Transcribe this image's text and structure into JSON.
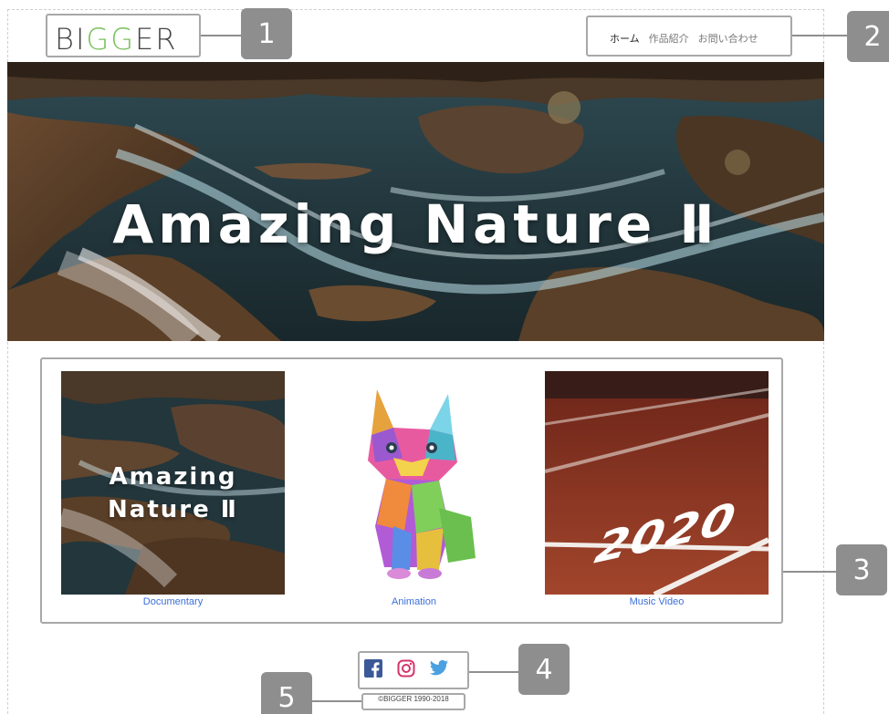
{
  "brand": {
    "logo_prefix": "BI",
    "logo_highlight": "GG",
    "logo_suffix": "ER"
  },
  "nav": {
    "items": [
      {
        "label": "ホーム"
      },
      {
        "label": "作品紹介"
      },
      {
        "label": "お問い合わせ"
      }
    ]
  },
  "hero": {
    "title": "Amazing Nature Ⅱ"
  },
  "works": {
    "items": [
      {
        "caption": "Documentary",
        "thumb_title": "Amazing\nNature Ⅱ"
      },
      {
        "caption": "Animation"
      },
      {
        "caption": "Music Video",
        "thumb_text": "2020"
      }
    ]
  },
  "social": {
    "icons": [
      "facebook-icon",
      "instagram-icon",
      "twitter-icon"
    ]
  },
  "footer": {
    "copyright": "©BIGGER 1990-2018"
  },
  "callouts": [
    "1",
    "2",
    "3",
    "4",
    "5"
  ],
  "colors": {
    "accent_green": "#78c05a",
    "link_blue": "#3a6fd8",
    "callout_gray": "#8e8e8e",
    "facebook": "#3b5998",
    "instagram": "#d6336c",
    "twitter": "#4aa0e0"
  }
}
